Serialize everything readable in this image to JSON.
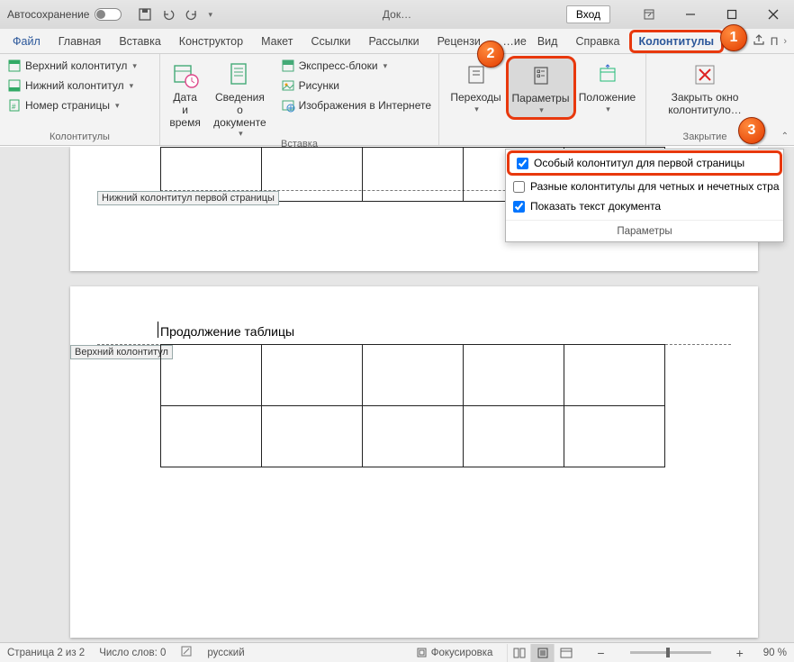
{
  "titlebar": {
    "autosave": "Автосохранение",
    "doc_title": "Док…",
    "login": "Вход"
  },
  "tabs": {
    "file": "Файл",
    "home": "Главная",
    "insert": "Вставка",
    "designer": "Конструктор",
    "layout": "Макет",
    "references": "Ссылки",
    "mailings": "Рассылки",
    "review": "Рецензи…",
    "truncated": "…ие",
    "view": "Вид",
    "help": "Справка",
    "header_footer": "Колонтитулы"
  },
  "ribbon": {
    "hf_group": {
      "header": "Верхний колонтитул",
      "footer": "Нижний колонтитул",
      "page_number": "Номер страницы",
      "label": "Колонтитулы"
    },
    "insert_group": {
      "date_time": "Дата и\nвремя",
      "doc_info": "Сведения о\nдокументе",
      "quick_parts": "Экспресс-блоки",
      "pictures": "Рисунки",
      "online_pictures": "Изображения в Интернете",
      "label": "Вставка"
    },
    "nav_group": {
      "transitions": "Переходы",
      "params": "Параметры",
      "position": "Положение"
    },
    "close_group": {
      "close": "Закрыть окно\nколонтитуло…",
      "label": "Закрытие"
    }
  },
  "options_popup": {
    "opt1": "Особый колонтитул для первой страницы",
    "opt2": "Разные колонтитулы для четных и нечетных стра",
    "opt3": "Показать текст документа",
    "title": "Параметры",
    "checked": {
      "opt1": true,
      "opt2": false,
      "opt3": true
    }
  },
  "document": {
    "footer_tag_p1": "Нижний колонтитул первой страницы",
    "header_tag_p2": "Верхний колонтитул",
    "continuation": "Продолжение таблицы"
  },
  "status": {
    "page": "Страница 2 из 2",
    "words": "Число слов: 0",
    "lang": "русский",
    "focus": "Фокусировка",
    "zoom": "90 %"
  }
}
